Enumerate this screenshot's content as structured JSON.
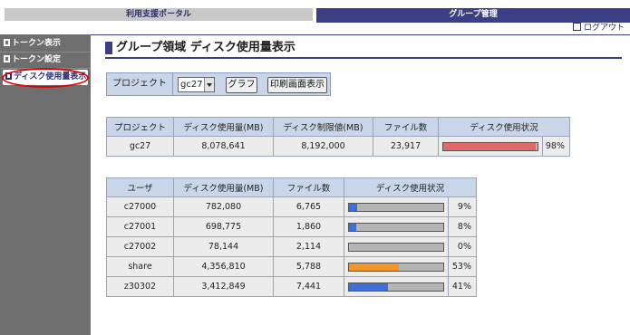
{
  "tabs": {
    "left": "利用支援ポータル",
    "right": "グループ管理"
  },
  "logout_label": "ログアウト",
  "sidebar": {
    "items": [
      {
        "label": "トークン表示"
      },
      {
        "label": "トークン設定"
      },
      {
        "label": "ディスク使用量表示"
      }
    ]
  },
  "page_title": "グループ領域 ディスク使用量表示",
  "project_bar": {
    "label": "プロジェクト",
    "selected": "gc27",
    "graph_button": "グラフ",
    "print_button": "印刷画面表示"
  },
  "project_table": {
    "headers": [
      "プロジェクト",
      "ディスク使用量(MB)",
      "ディスク制限値(MB)",
      "ファイル数",
      "ディスク使用状況"
    ],
    "row": {
      "project": "gc27",
      "usage": "8,078,641",
      "limit": "8,192,000",
      "files": "23,917",
      "percent": "98%",
      "fraction": 0.98,
      "bar_color": "#e06a6a"
    }
  },
  "user_table": {
    "headers": [
      "ユーザ",
      "ディスク使用量(MB)",
      "ファイル数",
      "ディスク使用状況"
    ],
    "rows": [
      {
        "user": "c27000",
        "usage": "782,080",
        "files": "6,765",
        "percent": "9%",
        "fraction": 0.09,
        "bar_color": "#3d6fd8"
      },
      {
        "user": "c27001",
        "usage": "698,775",
        "files": "1,860",
        "percent": "8%",
        "fraction": 0.08,
        "bar_color": "#3d6fd8"
      },
      {
        "user": "c27002",
        "usage": "78,144",
        "files": "2,114",
        "percent": "0%",
        "fraction": 0.0,
        "bar_color": "#3d6fd8"
      },
      {
        "user": "share",
        "usage": "4,356,810",
        "files": "5,788",
        "percent": "53%",
        "fraction": 0.53,
        "bar_color": "#f0962a"
      },
      {
        "user": "z30302",
        "usage": "3,412,849",
        "files": "7,441",
        "percent": "41%",
        "fraction": 0.41,
        "bar_color": "#3d6fd8"
      }
    ]
  },
  "colors": {
    "accent": "#3c3f86",
    "sidebar": "#6e6e6e",
    "table_header": "#c9d6ea",
    "highlight_ring": "#e00000"
  }
}
